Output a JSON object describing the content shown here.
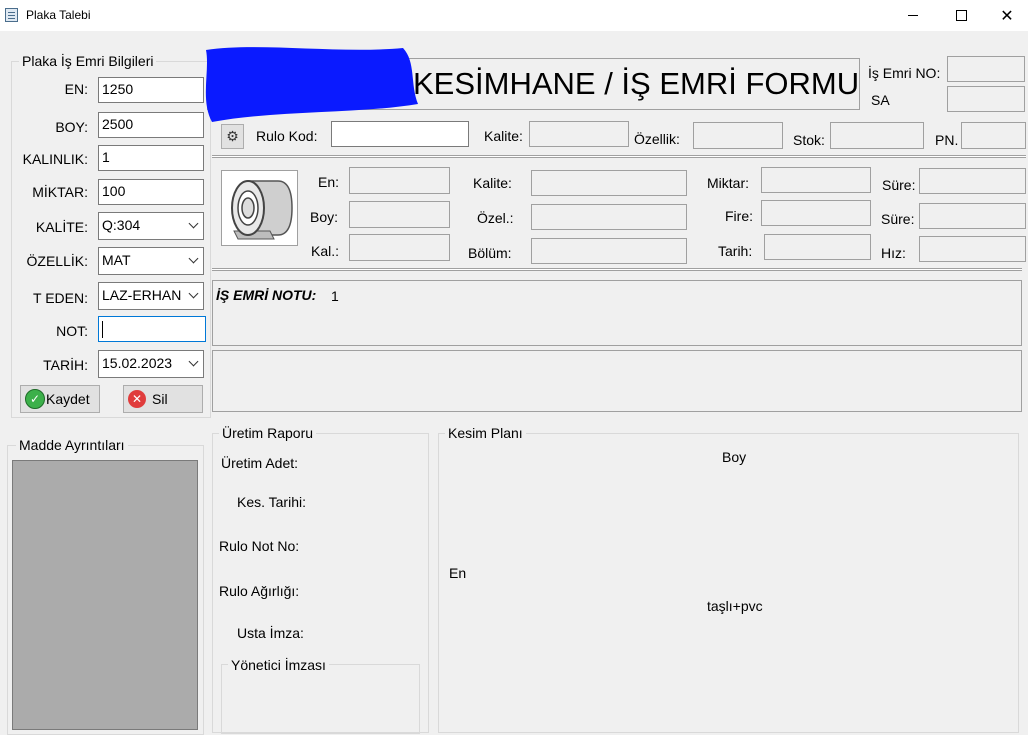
{
  "window": {
    "title": "Plaka Talebi"
  },
  "left_group": {
    "title": "Plaka İş Emri Bilgileri",
    "en_label": "EN:",
    "en_value": "1250",
    "boy_label": "BOY:",
    "boy_value": "2500",
    "kalinlik_label": "KALINLIK:",
    "kalinlik_value": "1",
    "miktar_label": "MİKTAR:",
    "miktar_value": "100",
    "kalite_label": "KALİTE:",
    "kalite_value": "Q:304",
    "ozellik_label": "ÖZELLİK:",
    "ozellik_value": "MAT",
    "teden_label": "T EDEN:",
    "teden_value": "LAZ-ERHAN",
    "not_label": "NOT:",
    "not_value": "",
    "tarih_label": "TARİH:",
    "tarih_value": "15.02.2023",
    "save_label": "Kaydet",
    "delete_label": "Sil"
  },
  "header": {
    "form_title": "KESİMHANE / İŞ EMRİ FORMU",
    "is_emri_no_label": "İş Emri NO:",
    "sa_label": "SA"
  },
  "rulo_row": {
    "rulo_kod_label": "Rulo Kod:",
    "kalite_label": "Kalite:",
    "ozellik_label": "Özellik:",
    "stok_label": "Stok:",
    "pn_label": "PN."
  },
  "detail": {
    "en_label": "En:",
    "boy_label": "Boy:",
    "kal_label": "Kal.:",
    "kalite_label": "Kalite:",
    "ozel_label": "Özel.:",
    "bolum_label": "Bölüm:",
    "miktar_label": "Miktar:",
    "fire_label": "Fire:",
    "tarih_label": "Tarih:",
    "sure1_label": "Süre:",
    "sure2_label": "Süre:",
    "hiz_label": "Hız:"
  },
  "note": {
    "label": "İŞ EMRİ NOTU:",
    "value": "1"
  },
  "madde": {
    "title": "Madde Ayrıntıları"
  },
  "uretim": {
    "title": "Üretim Raporu",
    "adet_label": "Üretim Adet:",
    "kes_tarihi_label": "Kes. Tarihi:",
    "rulo_not_label": "Rulo Not No:",
    "rulo_agirlik_label": "Rulo Ağırlığı:",
    "usta_imza_label": "Usta İmza:",
    "yonetici_title": "Yönetici İmzası"
  },
  "kesim": {
    "title": "Kesim Planı",
    "boy_label": "Boy",
    "en_label": "En",
    "material_label": "taşlı+pvc"
  },
  "colors": {
    "accent_green": "#3cb04a",
    "accent_red": "#e03c3c",
    "redaction_blue": "#0a1aff",
    "madde_fill": "#ababab"
  }
}
